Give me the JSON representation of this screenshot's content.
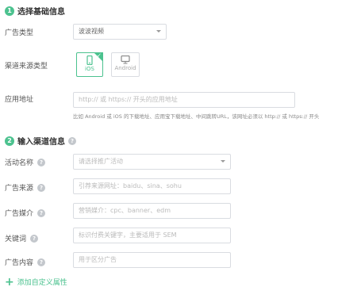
{
  "section1": {
    "number": "1",
    "title": "选择基础信息"
  },
  "ad_type": {
    "label": "广告类型",
    "value": "波波视频"
  },
  "channel_source_type": {
    "label": "渠道来源类型",
    "options": [
      {
        "label": "iOS",
        "selected": true,
        "icon": "phone-icon"
      },
      {
        "label": "Android",
        "selected": false,
        "icon": "monitor-icon"
      }
    ]
  },
  "app_address": {
    "label": "应用地址",
    "placeholder": "http:// 或 https:// 开头的应用地址",
    "hint": "比如 Android 或 iOS 的下载地址、应用宝下载地址、中间跳转URL，该网址必须以 http:// 或 https:// 开头"
  },
  "section2": {
    "number": "2",
    "title": "输入渠道信息"
  },
  "activity_name": {
    "label": "活动名称",
    "placeholder": "请选择推广活动"
  },
  "ad_source": {
    "label": "广告来源",
    "placeholder": "引荐来源网址：baidu、sina、sohu"
  },
  "ad_medium": {
    "label": "广告媒介",
    "placeholder": "营销媒介：cpc、banner、edm"
  },
  "keyword": {
    "label": "关键词",
    "placeholder": "标识付费关键字，主要适用于 SEM"
  },
  "ad_content": {
    "label": "广告内容",
    "placeholder": "用于区分广告"
  },
  "add_custom_attr": {
    "label": "添加自定义属性"
  },
  "colors": {
    "accent": "#4cc28f",
    "help_icon": "#c3c7cc",
    "border": "#d9dce1"
  }
}
